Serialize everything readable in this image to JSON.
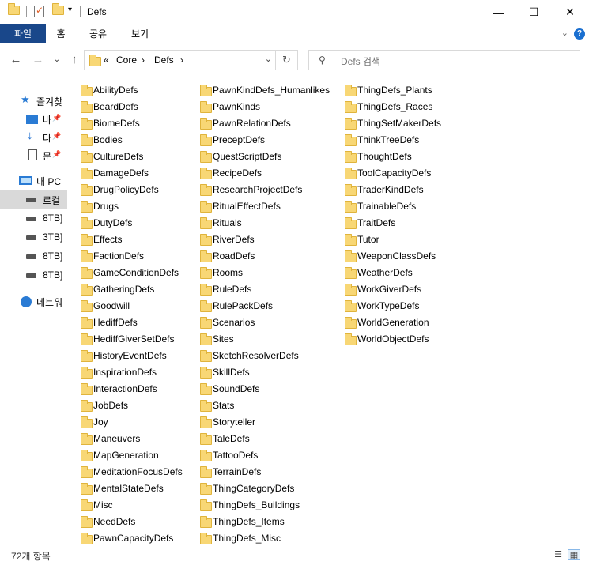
{
  "window": {
    "title": "Defs",
    "minimize_icon": "minimize-icon",
    "maximize_icon": "maximize-icon",
    "close_icon": "close-icon"
  },
  "ribbon": {
    "tabs": [
      "파일",
      "홈",
      "공유",
      "보기"
    ],
    "active_tab_color": "#19478a"
  },
  "nav": {
    "overflow": "«",
    "path": [
      "Core",
      "Defs"
    ],
    "search_placeholder": "Defs 검색"
  },
  "sidebar": {
    "items": [
      {
        "label": "즐겨찾",
        "icon": "star-icon"
      },
      {
        "label": "바",
        "icon": "desktop-icon",
        "pinned": true
      },
      {
        "label": "다",
        "icon": "download-icon",
        "pinned": true
      },
      {
        "label": "문",
        "icon": "document-icon",
        "pinned": true
      },
      {
        "label": "내 PC",
        "icon": "pc-icon"
      },
      {
        "label": "로컬",
        "icon": "local-disk-icon",
        "selected": true
      },
      {
        "label": "8TB]",
        "icon": "drive-icon"
      },
      {
        "label": "3TB]",
        "icon": "drive-icon"
      },
      {
        "label": "8TB]",
        "icon": "drive-icon"
      },
      {
        "label": "8TB]",
        "icon": "drive-icon"
      },
      {
        "label": "네트워",
        "icon": "network-icon"
      }
    ]
  },
  "folders": {
    "col1": [
      "AbilityDefs",
      "BeardDefs",
      "BiomeDefs",
      "Bodies",
      "CultureDefs",
      "DamageDefs",
      "DrugPolicyDefs",
      "Drugs",
      "DutyDefs",
      "Effects",
      "FactionDefs",
      "GameConditionDefs",
      "GatheringDefs",
      "Goodwill",
      "HediffDefs",
      "HediffGiverSetDefs",
      "HistoryEventDefs",
      "InspirationDefs",
      "InteractionDefs",
      "JobDefs",
      "Joy",
      "Maneuvers",
      "MapGeneration",
      "MeditationFocusDefs",
      "MentalStateDefs",
      "Misc",
      "NeedDefs",
      "PawnCapacityDefs"
    ],
    "col2": [
      "PawnKindDefs_Humanlikes",
      "PawnKinds",
      "PawnRelationDefs",
      "PreceptDefs",
      "QuestScriptDefs",
      "RecipeDefs",
      "ResearchProjectDefs",
      "RitualEffectDefs",
      "Rituals",
      "RiverDefs",
      "RoadDefs",
      "Rooms",
      "RuleDefs",
      "RulePackDefs",
      "Scenarios",
      "Sites",
      "SketchResolverDefs",
      "SkillDefs",
      "SoundDefs",
      "Stats",
      "Storyteller",
      "TaleDefs",
      "TattooDefs",
      "TerrainDefs",
      "ThingCategoryDefs",
      "ThingDefs_Buildings",
      "ThingDefs_Items",
      "ThingDefs_Misc"
    ],
    "col3": [
      "ThingDefs_Plants",
      "ThingDefs_Races",
      "ThingSetMakerDefs",
      "ThinkTreeDefs",
      "ThoughtDefs",
      "ToolCapacityDefs",
      "TraderKindDefs",
      "TrainableDefs",
      "TraitDefs",
      "Tutor",
      "WeaponClassDefs",
      "WeatherDefs",
      "WorkGiverDefs",
      "WorkTypeDefs",
      "WorldGeneration",
      "WorldObjectDefs"
    ]
  },
  "status": {
    "item_count": "72개 항목"
  }
}
